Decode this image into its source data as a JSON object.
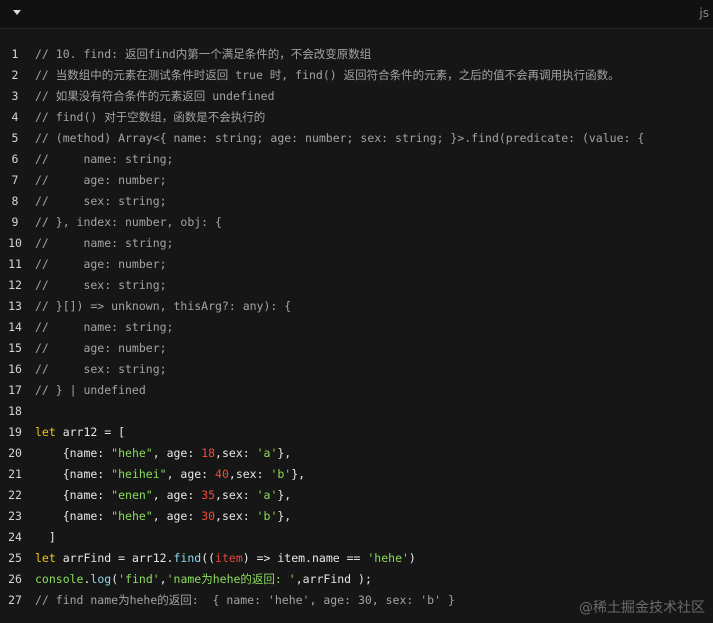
{
  "toolbar": {
    "collapse_icon": "caret-down-icon",
    "language": "js"
  },
  "watermark": "@稀土掘金技术社区",
  "lines": [
    {
      "n": "1",
      "segs": [
        {
          "t": "// 10. find: 返回find内第一个满足条件的，不会改变原数组",
          "c": "cm"
        }
      ]
    },
    {
      "n": "2",
      "segs": [
        {
          "t": "// 当数组中的元素在测试条件时返回 true 时, find() 返回符合条件的元素，之后的值不会再调用执行函数。",
          "c": "cm"
        }
      ]
    },
    {
      "n": "3",
      "segs": [
        {
          "t": "// 如果没有符合条件的元素返回 undefined",
          "c": "cm"
        }
      ]
    },
    {
      "n": "4",
      "segs": [
        {
          "t": "// find() 对于空数组，函数是不会执行的",
          "c": "cm"
        }
      ]
    },
    {
      "n": "5",
      "segs": [
        {
          "t": "// (method) Array<{ name: string; age: number; sex: string; }>.find(predicate: (value: {",
          "c": "cm"
        }
      ]
    },
    {
      "n": "6",
      "segs": [
        {
          "t": "//     name: string;",
          "c": "cm"
        }
      ]
    },
    {
      "n": "7",
      "segs": [
        {
          "t": "//     age: number;",
          "c": "cm"
        }
      ]
    },
    {
      "n": "8",
      "segs": [
        {
          "t": "//     sex: string;",
          "c": "cm"
        }
      ]
    },
    {
      "n": "9",
      "segs": [
        {
          "t": "// }, index: number, obj: {",
          "c": "cm"
        }
      ]
    },
    {
      "n": "10",
      "segs": [
        {
          "t": "//     name: string;",
          "c": "cm"
        }
      ]
    },
    {
      "n": "11",
      "segs": [
        {
          "t": "//     age: number;",
          "c": "cm"
        }
      ]
    },
    {
      "n": "12",
      "segs": [
        {
          "t": "//     sex: string;",
          "c": "cm"
        }
      ]
    },
    {
      "n": "13",
      "segs": [
        {
          "t": "// }[]) => unknown, thisArg?: any): {",
          "c": "cm"
        }
      ]
    },
    {
      "n": "14",
      "segs": [
        {
          "t": "//     name: string;",
          "c": "cm"
        }
      ]
    },
    {
      "n": "15",
      "segs": [
        {
          "t": "//     age: number;",
          "c": "cm"
        }
      ]
    },
    {
      "n": "16",
      "segs": [
        {
          "t": "//     sex: string;",
          "c": "cm"
        }
      ]
    },
    {
      "n": "17",
      "segs": [
        {
          "t": "// } | undefined",
          "c": "cm"
        }
      ]
    },
    {
      "n": "18",
      "segs": []
    },
    {
      "n": "19",
      "segs": [
        {
          "t": "let",
          "c": "kw"
        },
        {
          "t": " arr12 = [",
          "c": "plain"
        }
      ]
    },
    {
      "n": "20",
      "segs": [
        {
          "t": "    {name: ",
          "c": "plain"
        },
        {
          "t": "\"hehe\"",
          "c": "str"
        },
        {
          "t": ", age: ",
          "c": "plain"
        },
        {
          "t": "18",
          "c": "num"
        },
        {
          "t": ",sex: ",
          "c": "plain"
        },
        {
          "t": "'a'",
          "c": "str"
        },
        {
          "t": "},",
          "c": "plain"
        }
      ]
    },
    {
      "n": "21",
      "segs": [
        {
          "t": "    {name: ",
          "c": "plain"
        },
        {
          "t": "\"heihei\"",
          "c": "str"
        },
        {
          "t": ", age: ",
          "c": "plain"
        },
        {
          "t": "40",
          "c": "num"
        },
        {
          "t": ",sex: ",
          "c": "plain"
        },
        {
          "t": "'b'",
          "c": "str"
        },
        {
          "t": "},",
          "c": "plain"
        }
      ]
    },
    {
      "n": "22",
      "segs": [
        {
          "t": "    {name: ",
          "c": "plain"
        },
        {
          "t": "\"enen\"",
          "c": "str"
        },
        {
          "t": ", age: ",
          "c": "plain"
        },
        {
          "t": "35",
          "c": "num"
        },
        {
          "t": ",sex: ",
          "c": "plain"
        },
        {
          "t": "'a'",
          "c": "str"
        },
        {
          "t": "},",
          "c": "plain"
        }
      ]
    },
    {
      "n": "23",
      "segs": [
        {
          "t": "    {name: ",
          "c": "plain"
        },
        {
          "t": "\"hehe\"",
          "c": "str"
        },
        {
          "t": ", age: ",
          "c": "plain"
        },
        {
          "t": "30",
          "c": "num"
        },
        {
          "t": ",sex: ",
          "c": "plain"
        },
        {
          "t": "'b'",
          "c": "str"
        },
        {
          "t": "},",
          "c": "plain"
        }
      ]
    },
    {
      "n": "24",
      "segs": [
        {
          "t": "  ]",
          "c": "plain"
        }
      ]
    },
    {
      "n": "25",
      "segs": [
        {
          "t": "let",
          "c": "kw"
        },
        {
          "t": " arrFind = arr12.",
          "c": "plain"
        },
        {
          "t": "find",
          "c": "fn"
        },
        {
          "t": "((",
          "c": "plain"
        },
        {
          "t": "item",
          "c": "param"
        },
        {
          "t": ") => item.name == ",
          "c": "plain"
        },
        {
          "t": "'hehe'",
          "c": "str"
        },
        {
          "t": ")",
          "c": "plain"
        }
      ]
    },
    {
      "n": "26",
      "segs": [
        {
          "t": "console",
          "c": "builtin"
        },
        {
          "t": ".",
          "c": "plain"
        },
        {
          "t": "log",
          "c": "fn"
        },
        {
          "t": "(",
          "c": "plain"
        },
        {
          "t": "'find'",
          "c": "str"
        },
        {
          "t": ",",
          "c": "plain"
        },
        {
          "t": "'name为hehe的返回: '",
          "c": "str"
        },
        {
          "t": ",arrFind );",
          "c": "plain"
        }
      ]
    },
    {
      "n": "27",
      "segs": [
        {
          "t": "// find name为hehe的返回:  { name: 'hehe', age: 30, sex: 'b' }",
          "c": "cm"
        }
      ]
    }
  ]
}
